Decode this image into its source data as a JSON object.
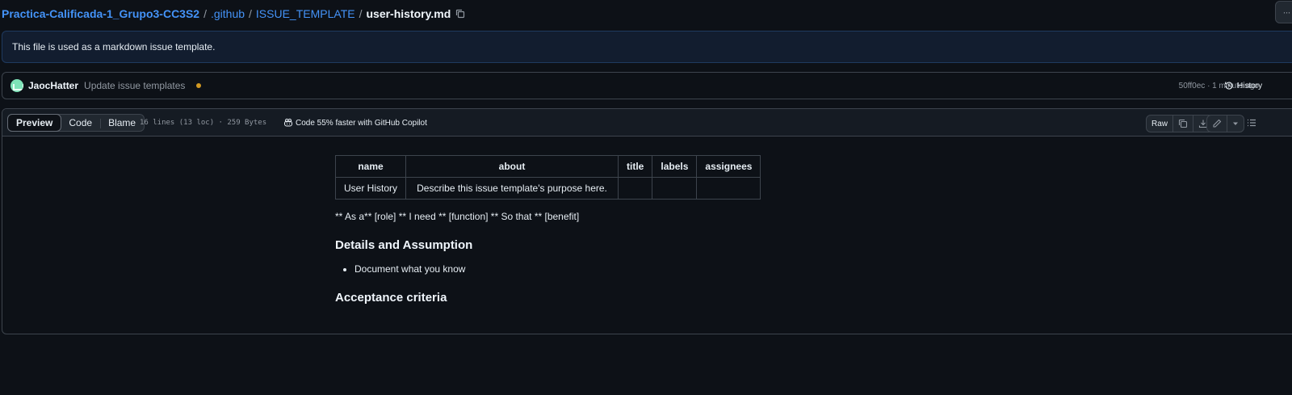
{
  "breadcrumb": {
    "repo": "Practica-Calificada-1_Grupo3-CC3S2",
    "sep": "/",
    "folder1": ".github",
    "folder2": "ISSUE_TEMPLATE",
    "file": "user-history.md",
    "copy_icon": "copy-icon"
  },
  "more_button": {
    "label": "···"
  },
  "banner": {
    "text": "This file is used as a markdown issue template."
  },
  "commit": {
    "author": "JaocHatter",
    "message": "Update issue templates",
    "hash_time": "50ff0ec · 1 minute ago",
    "history_label": "History",
    "status_color": "#d29922"
  },
  "file_header": {
    "tabs": [
      "Preview",
      "Code",
      "Blame"
    ],
    "meta": "16 lines (13 loc) · 259 Bytes",
    "copilot": "Code 55% faster with GitHub Copilot",
    "raw_label": "Raw"
  },
  "markdown": {
    "table": {
      "headers": [
        "name",
        "about",
        "title",
        "labels",
        "assignees"
      ],
      "rows": [
        [
          "User History",
          "Describe this issue template's purpose here.",
          "",
          "",
          ""
        ]
      ]
    },
    "paragraph": "** As a** [role] ** I need ** [function] ** So that ** [benefit]",
    "heading1": "Details and Assumption",
    "list": [
      "Document what you know"
    ],
    "heading2": "Acceptance criteria"
  },
  "colors": {
    "background": "#0d1117",
    "accent": "#4493f8",
    "border": "#3d444d"
  }
}
